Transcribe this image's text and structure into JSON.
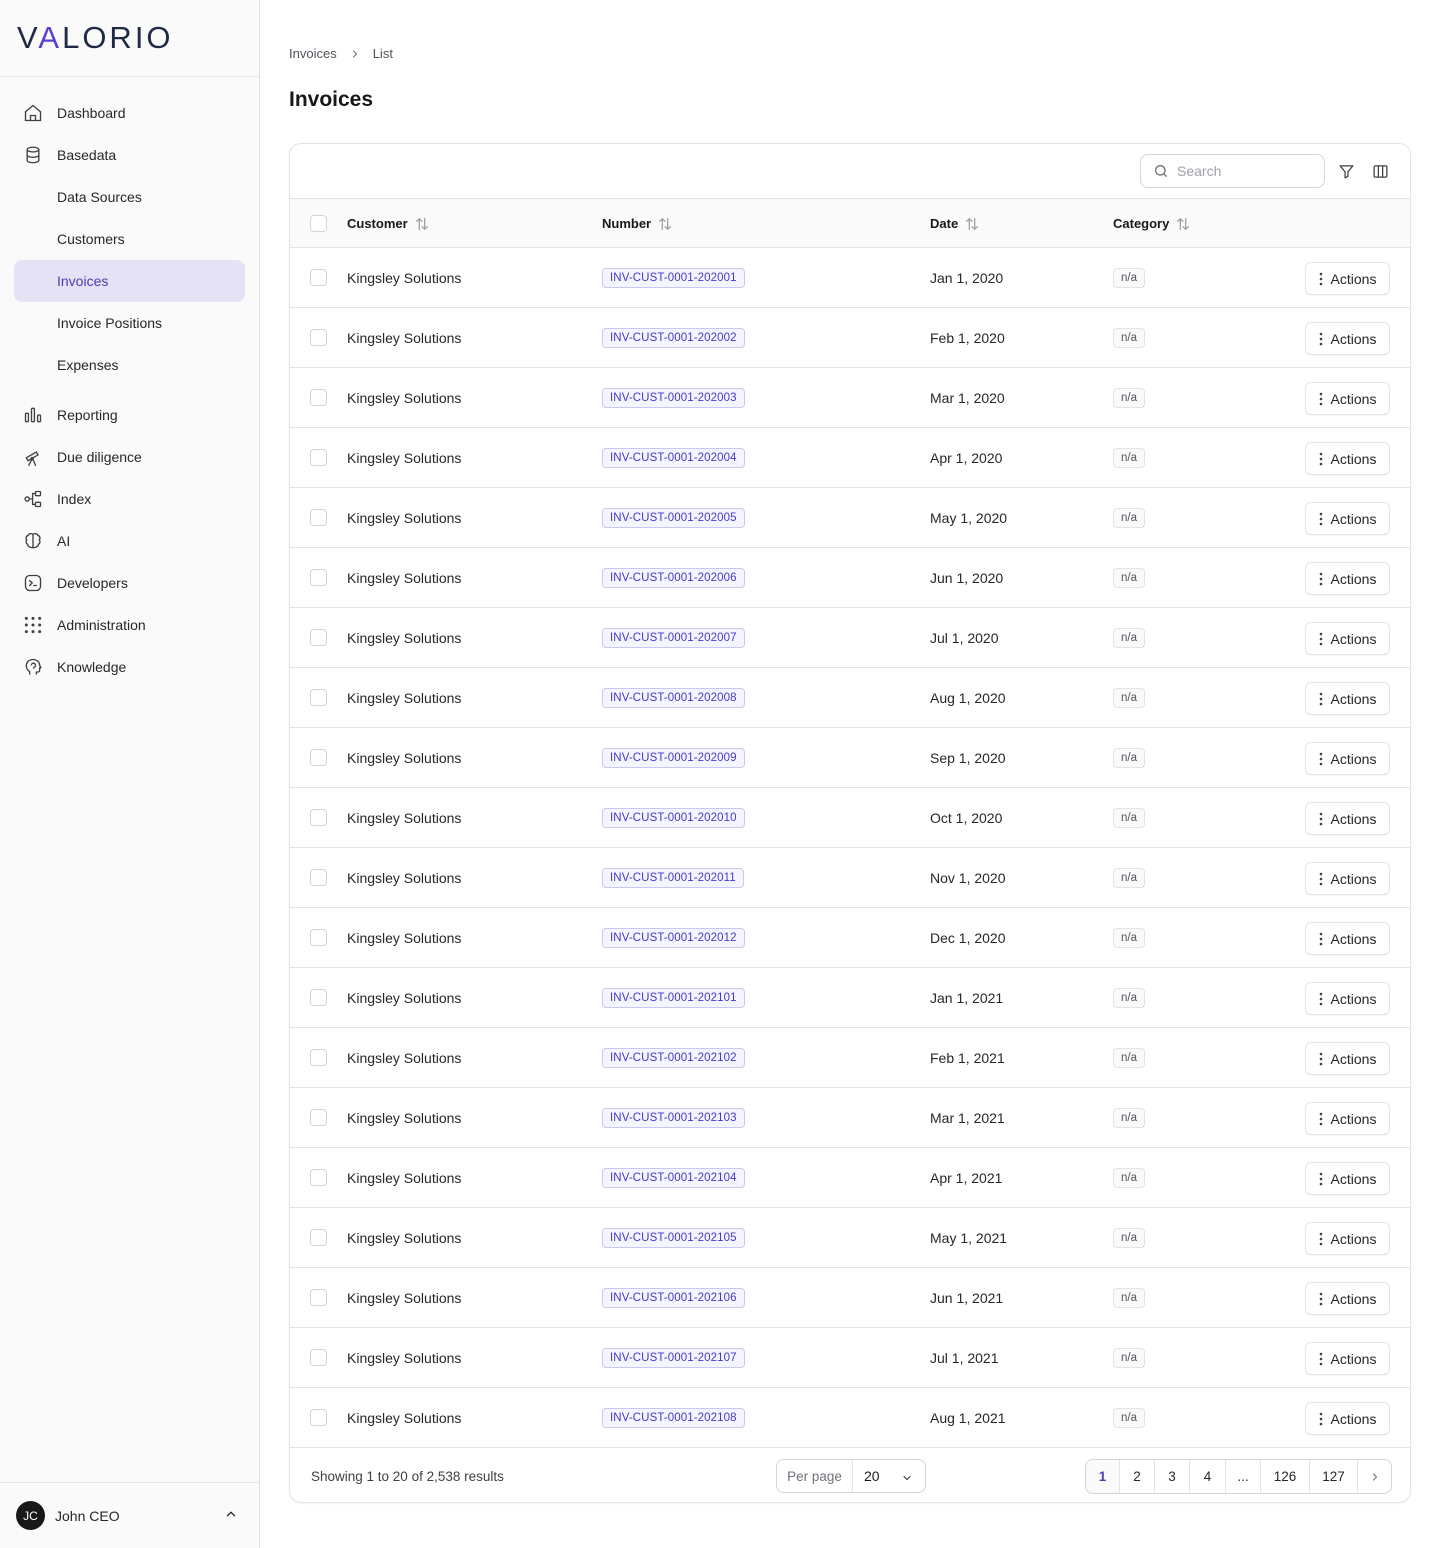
{
  "brand": {
    "logo_left": "V",
    "logo_accent": "A",
    "logo_rest": "LORIO",
    "accent_color": "#5b3fd1"
  },
  "sidebar": {
    "items": [
      {
        "label": "Dashboard",
        "icon": "home-icon"
      },
      {
        "label": "Basedata",
        "icon": "database-icon"
      }
    ],
    "sub_items": [
      {
        "label": "Data Sources",
        "active": false
      },
      {
        "label": "Customers",
        "active": false
      },
      {
        "label": "Invoices",
        "active": true
      },
      {
        "label": "Invoice Positions",
        "active": false
      },
      {
        "label": "Expenses",
        "active": false
      }
    ],
    "items_after": [
      {
        "label": "Reporting",
        "icon": "bar-chart-icon"
      },
      {
        "label": "Due diligence",
        "icon": "telescope-icon"
      },
      {
        "label": "Index",
        "icon": "network-icon"
      },
      {
        "label": "AI",
        "icon": "brain-icon"
      },
      {
        "label": "Developers",
        "icon": "terminal-icon"
      },
      {
        "label": "Administration",
        "icon": "grid-dots-icon"
      },
      {
        "label": "Knowledge",
        "icon": "head-icon"
      }
    ]
  },
  "user": {
    "initials": "JC",
    "name": "John CEO"
  },
  "breadcrumb": {
    "root": "Invoices",
    "current": "List"
  },
  "page": {
    "title": "Invoices"
  },
  "search": {
    "placeholder": "Search",
    "value": ""
  },
  "table": {
    "columns": [
      "Customer",
      "Number",
      "Date",
      "Category"
    ],
    "action_label": "Actions",
    "rows": [
      {
        "customer": "Kingsley Solutions",
        "number": "INV-CUST-0001-202001",
        "date": "Jan 1, 2020",
        "category": "n/a"
      },
      {
        "customer": "Kingsley Solutions",
        "number": "INV-CUST-0001-202002",
        "date": "Feb 1, 2020",
        "category": "n/a"
      },
      {
        "customer": "Kingsley Solutions",
        "number": "INV-CUST-0001-202003",
        "date": "Mar 1, 2020",
        "category": "n/a"
      },
      {
        "customer": "Kingsley Solutions",
        "number": "INV-CUST-0001-202004",
        "date": "Apr 1, 2020",
        "category": "n/a"
      },
      {
        "customer": "Kingsley Solutions",
        "number": "INV-CUST-0001-202005",
        "date": "May 1, 2020",
        "category": "n/a"
      },
      {
        "customer": "Kingsley Solutions",
        "number": "INV-CUST-0001-202006",
        "date": "Jun 1, 2020",
        "category": "n/a"
      },
      {
        "customer": "Kingsley Solutions",
        "number": "INV-CUST-0001-202007",
        "date": "Jul 1, 2020",
        "category": "n/a"
      },
      {
        "customer": "Kingsley Solutions",
        "number": "INV-CUST-0001-202008",
        "date": "Aug 1, 2020",
        "category": "n/a"
      },
      {
        "customer": "Kingsley Solutions",
        "number": "INV-CUST-0001-202009",
        "date": "Sep 1, 2020",
        "category": "n/a"
      },
      {
        "customer": "Kingsley Solutions",
        "number": "INV-CUST-0001-202010",
        "date": "Oct 1, 2020",
        "category": "n/a"
      },
      {
        "customer": "Kingsley Solutions",
        "number": "INV-CUST-0001-202011",
        "date": "Nov 1, 2020",
        "category": "n/a"
      },
      {
        "customer": "Kingsley Solutions",
        "number": "INV-CUST-0001-202012",
        "date": "Dec 1, 2020",
        "category": "n/a"
      },
      {
        "customer": "Kingsley Solutions",
        "number": "INV-CUST-0001-202101",
        "date": "Jan 1, 2021",
        "category": "n/a"
      },
      {
        "customer": "Kingsley Solutions",
        "number": "INV-CUST-0001-202102",
        "date": "Feb 1, 2021",
        "category": "n/a"
      },
      {
        "customer": "Kingsley Solutions",
        "number": "INV-CUST-0001-202103",
        "date": "Mar 1, 2021",
        "category": "n/a"
      },
      {
        "customer": "Kingsley Solutions",
        "number": "INV-CUST-0001-202104",
        "date": "Apr 1, 2021",
        "category": "n/a"
      },
      {
        "customer": "Kingsley Solutions",
        "number": "INV-CUST-0001-202105",
        "date": "May 1, 2021",
        "category": "n/a"
      },
      {
        "customer": "Kingsley Solutions",
        "number": "INV-CUST-0001-202106",
        "date": "Jun 1, 2021",
        "category": "n/a"
      },
      {
        "customer": "Kingsley Solutions",
        "number": "INV-CUST-0001-202107",
        "date": "Jul 1, 2021",
        "category": "n/a"
      },
      {
        "customer": "Kingsley Solutions",
        "number": "INV-CUST-0001-202108",
        "date": "Aug 1, 2021",
        "category": "n/a"
      }
    ]
  },
  "pagination": {
    "summary": "Showing 1 to 20 of 2,538 results",
    "per_page_label": "Per page",
    "per_page_value": "20",
    "pages": [
      "1",
      "2",
      "3",
      "4",
      "...",
      "126",
      "127"
    ],
    "current_page": "1"
  }
}
